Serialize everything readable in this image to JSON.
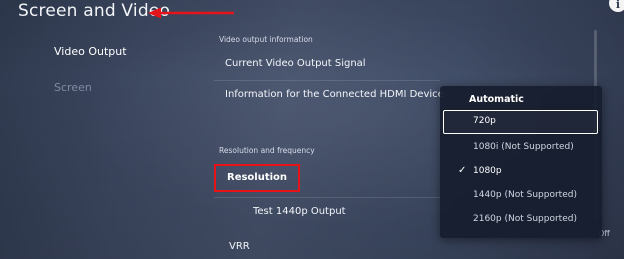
{
  "header": {
    "title": "Screen and Video",
    "info_icon": "i"
  },
  "sidebar": {
    "items": [
      {
        "label": "Video Output",
        "selected": true
      },
      {
        "label": "Screen",
        "selected": false
      }
    ]
  },
  "main": {
    "video_output_info": {
      "section_label": "Video output information",
      "rows": [
        "Current Video Output Signal",
        "Information for the Connected HDMI Device"
      ]
    },
    "resolution_frequency": {
      "section_label": "Resolution and frequency",
      "resolution_label": "Resolution",
      "test_label": "Test 1440p Output",
      "vrr_label": "VRR",
      "vrr_value": "Off"
    }
  },
  "dropdown": {
    "header": "Automatic",
    "options": [
      {
        "label": "720p",
        "focused": true,
        "checked": false
      },
      {
        "label": "1080i (Not Supported)",
        "focused": false,
        "checked": false
      },
      {
        "label": "1080p",
        "focused": false,
        "checked": true
      },
      {
        "label": "1440p (Not Supported)",
        "focused": false,
        "checked": false
      },
      {
        "label": "2160p (Not Supported)",
        "focused": false,
        "checked": false
      }
    ],
    "check_glyph": "✓"
  },
  "colors": {
    "annotation_red": "#e5141b",
    "background": "#3d4860",
    "menu_bg": "#161d2e"
  },
  "icons": {
    "arrow": "red-arrow-icon",
    "info": "info-icon",
    "check": "checkmark-icon"
  }
}
